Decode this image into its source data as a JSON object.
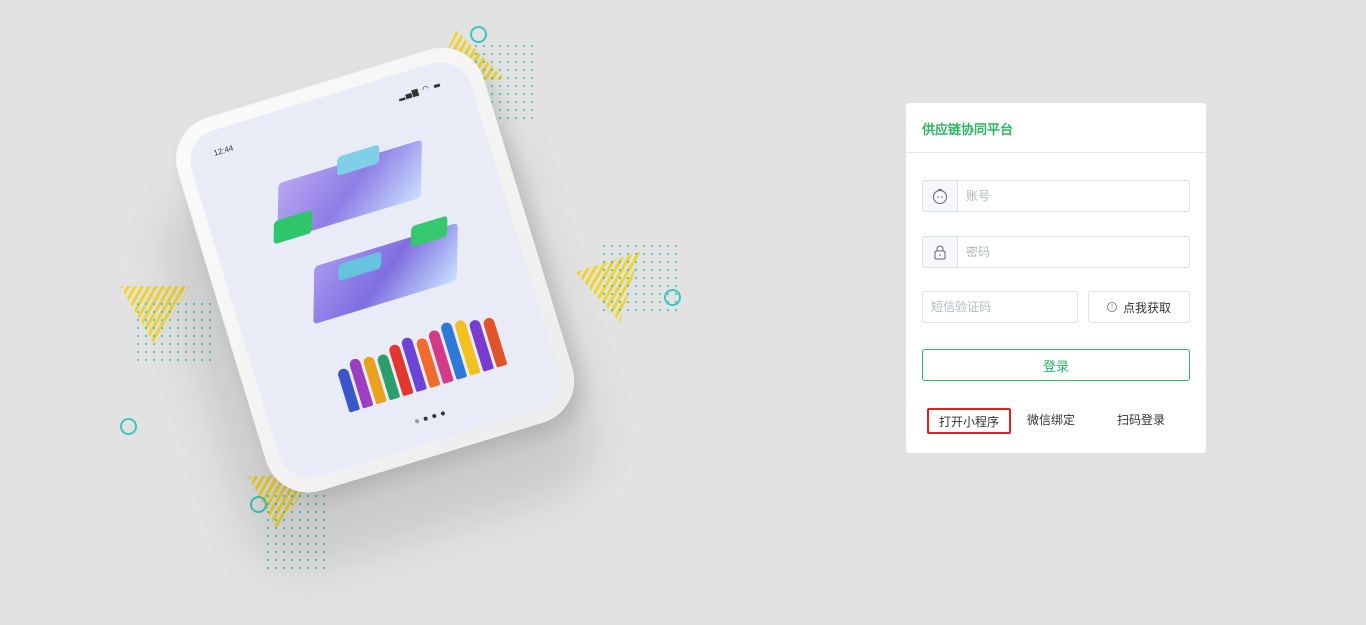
{
  "login": {
    "title": "供应链协同平台",
    "account_placeholder": "账号",
    "password_placeholder": "密码",
    "sms_placeholder": "短信验证码",
    "get_code_label": "点我获取",
    "login_label": "登录",
    "links": [
      "打开小程序",
      "微信绑定",
      "扫码登录"
    ]
  },
  "phone": {
    "time": "12:44",
    "status_icons": "▂▄▆ ◠ ▬"
  },
  "colors": {
    "brand_green": "#2db664",
    "highlight_red": "#e02020",
    "background": "#e2e2e2",
    "deco_teal": "#3cc6be",
    "deco_yellow": "#f2d42b"
  },
  "icons": {
    "account": "user-face-icon",
    "password": "lock-icon",
    "get_code": "info-icon"
  }
}
